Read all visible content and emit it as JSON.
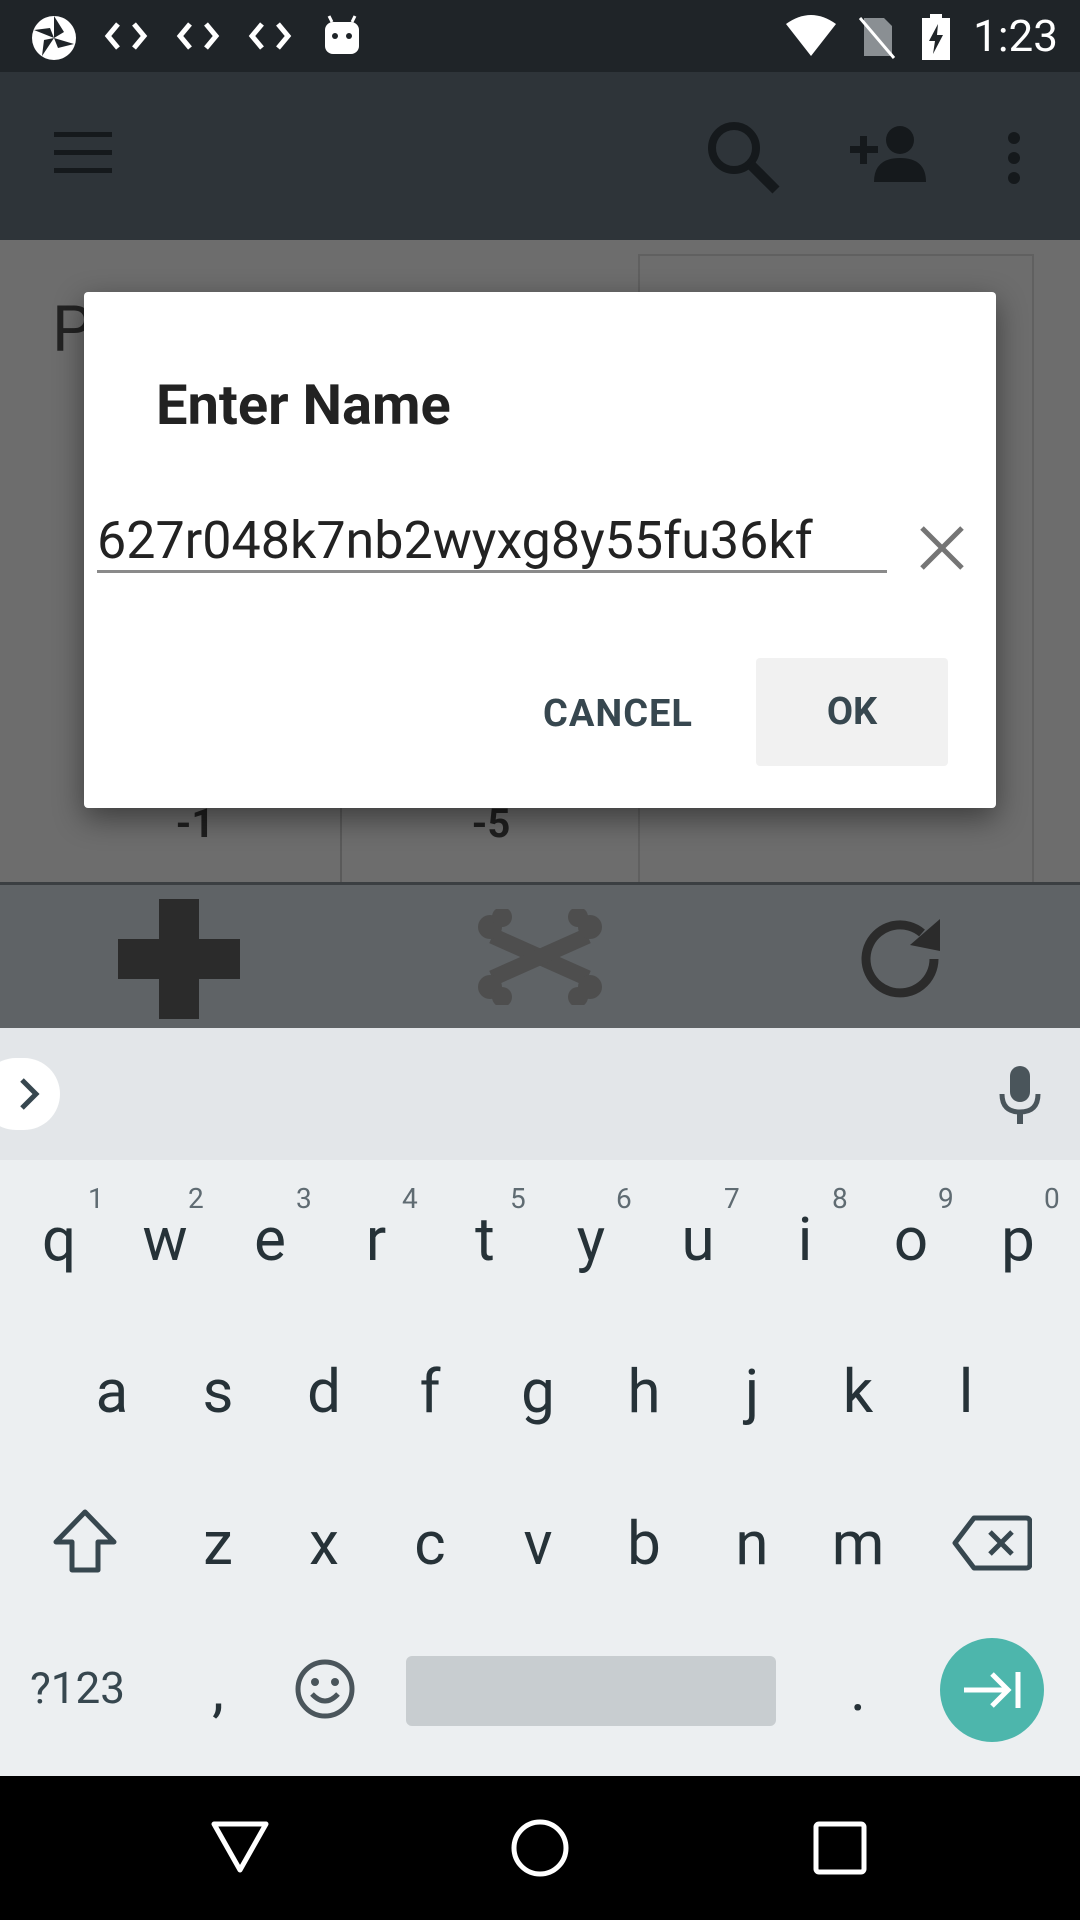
{
  "status_bar": {
    "time": "1:23",
    "icons": [
      "pinwheel-icon",
      "code-icon",
      "code-icon",
      "code-icon",
      "android-icon",
      "wifi-icon",
      "no-sim-icon",
      "battery-charging-icon"
    ]
  },
  "app_bar": {
    "icons": [
      "menu-icon",
      "search-icon",
      "add-person-icon",
      "more-vert-icon"
    ]
  },
  "background": {
    "partial_title": "P",
    "counter_a": "-1",
    "counter_b": "-5"
  },
  "dialog": {
    "title": "Enter Name",
    "input_value": "627r048k7nb2wyxg8y55fu36kf",
    "cancel_label": "CANCEL",
    "ok_label": "OK"
  },
  "keyboard": {
    "row1": [
      {
        "key": "q",
        "hint": "1"
      },
      {
        "key": "w",
        "hint": "2"
      },
      {
        "key": "e",
        "hint": "3"
      },
      {
        "key": "r",
        "hint": "4"
      },
      {
        "key": "t",
        "hint": "5"
      },
      {
        "key": "y",
        "hint": "6"
      },
      {
        "key": "u",
        "hint": "7"
      },
      {
        "key": "i",
        "hint": "8"
      },
      {
        "key": "o",
        "hint": "9"
      },
      {
        "key": "p",
        "hint": "0"
      }
    ],
    "row2": [
      "a",
      "s",
      "d",
      "f",
      "g",
      "h",
      "j",
      "k",
      "l"
    ],
    "row3": [
      "z",
      "x",
      "c",
      "v",
      "b",
      "n",
      "m"
    ],
    "symbols_label": "?123",
    "comma": ",",
    "period": ".",
    "accent_color": "#4db6ac"
  }
}
